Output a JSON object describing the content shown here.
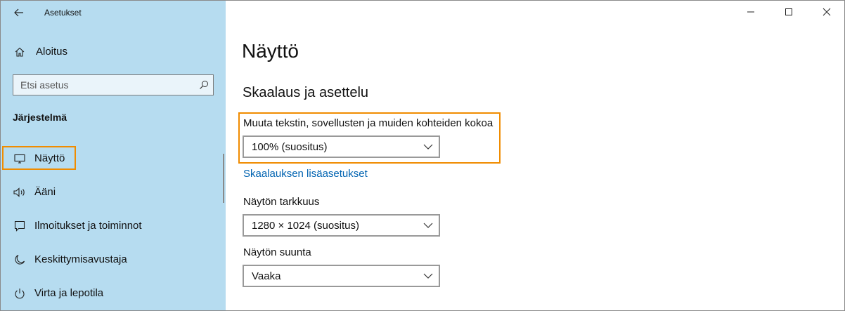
{
  "window": {
    "title": "Asetukset",
    "icons": {
      "back": "back-arrow-icon",
      "minimize": "minimize-icon",
      "maximize": "maximize-icon",
      "close": "close-icon"
    }
  },
  "sidebar": {
    "home_label": "Aloitus",
    "search": {
      "placeholder": "Etsi asetus",
      "value": ""
    },
    "section_label": "Järjestelmä",
    "items": [
      {
        "label": "Näyttö",
        "icon": "monitor-icon",
        "selected": true
      },
      {
        "label": "Ääni",
        "icon": "speaker-icon",
        "selected": false
      },
      {
        "label": "Ilmoitukset ja toiminnot",
        "icon": "notification-icon",
        "selected": false
      },
      {
        "label": "Keskittymisavustaja",
        "icon": "moon-icon",
        "selected": false
      },
      {
        "label": "Virta ja lepotila",
        "icon": "power-icon",
        "selected": false
      }
    ]
  },
  "main": {
    "title": "Näyttö",
    "scaling_section": "Skaalaus ja asettelu",
    "scale": {
      "label": "Muuta tekstin, sovellusten ja muiden kohteiden kokoa",
      "value": "100% (suositus)"
    },
    "advanced_link": "Skaalauksen lisäasetukset",
    "resolution": {
      "label": "Näytön tarkkuus",
      "value": "1280 × 1024 (suositus)"
    },
    "orientation": {
      "label": "Näytön suunta",
      "value": "Vaaka"
    }
  },
  "colors": {
    "sidebar_bg": "#b6dcf0",
    "highlight": "#f08c00",
    "link": "#0063b1"
  }
}
